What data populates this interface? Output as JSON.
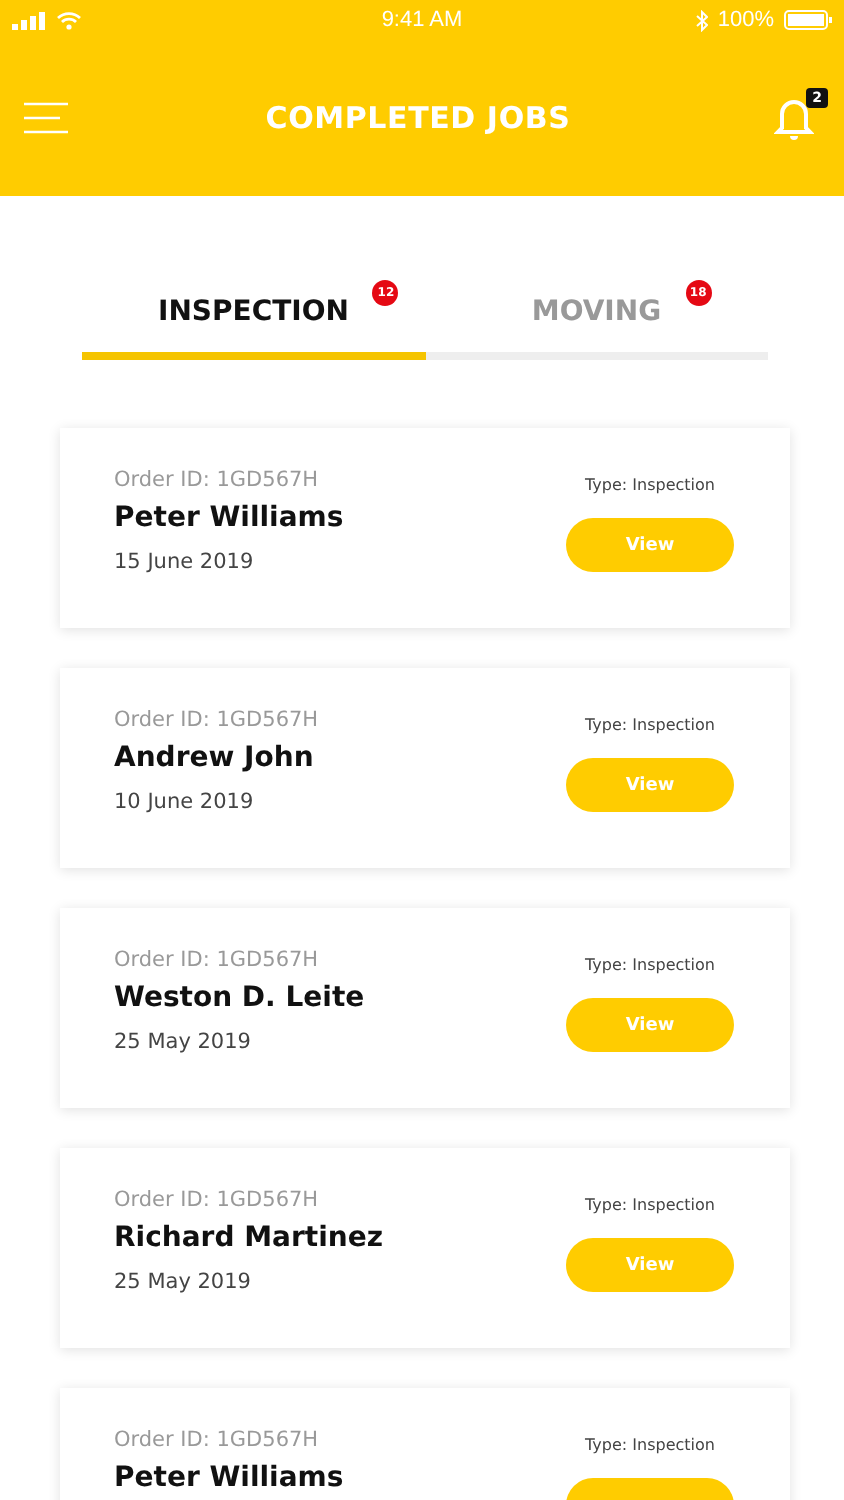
{
  "status_bar": {
    "time": "9:41 AM",
    "battery": "100%"
  },
  "header": {
    "title": "COMPLETED JOBS",
    "notification_count": "2"
  },
  "tabs": [
    {
      "label": "INSPECTION",
      "badge": "12",
      "selected": true
    },
    {
      "label": "MOVING",
      "badge": "18",
      "selected": false
    }
  ],
  "jobs": [
    {
      "order_id": "Order ID: 1GD567H",
      "name": "Peter Williams",
      "date": "15 June 2019",
      "type": "Type: Inspection",
      "button": "View"
    },
    {
      "order_id": "Order ID: 1GD567H",
      "name": "Andrew John",
      "date": "10 June 2019",
      "type": "Type: Inspection",
      "button": "View"
    },
    {
      "order_id": "Order ID: 1GD567H",
      "name": "Weston D. Leite",
      "date": "25 May 2019",
      "type": "Type: Inspection",
      "button": "View"
    },
    {
      "order_id": "Order ID: 1GD567H",
      "name": "Richard Martinez",
      "date": "25 May 2019",
      "type": "Type: Inspection",
      "button": "View"
    },
    {
      "order_id": "Order ID: 1GD567H",
      "name": "Peter Williams",
      "type": "Type: Inspection"
    }
  ]
}
